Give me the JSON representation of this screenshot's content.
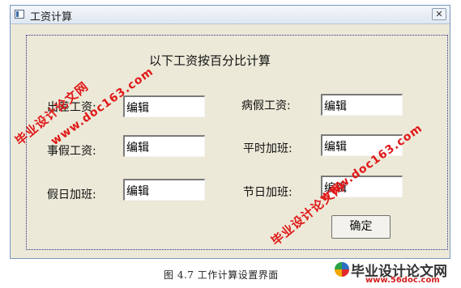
{
  "window": {
    "title": "工资计算",
    "close_label": "✕"
  },
  "dialog": {
    "heading": "以下工资按百分比计算",
    "fields": [
      {
        "label": "出差工资:",
        "value": "编辑"
      },
      {
        "label": "病假工资:",
        "value": "编辑"
      },
      {
        "label": "事假工资:",
        "value": "编辑"
      },
      {
        "label": "平时加班:",
        "value": "编辑"
      },
      {
        "label": "假日加班:",
        "value": "编辑"
      },
      {
        "label": "节日加班:",
        "value": "编辑"
      }
    ],
    "ok_label": "确定"
  },
  "caption": "图 4.7 工作计算设置界面",
  "watermarks": [
    "毕业设计论文网",
    "www.doc163.com"
  ],
  "brand": {
    "name": "毕业设计论文网",
    "url": "www.56doc.com"
  }
}
